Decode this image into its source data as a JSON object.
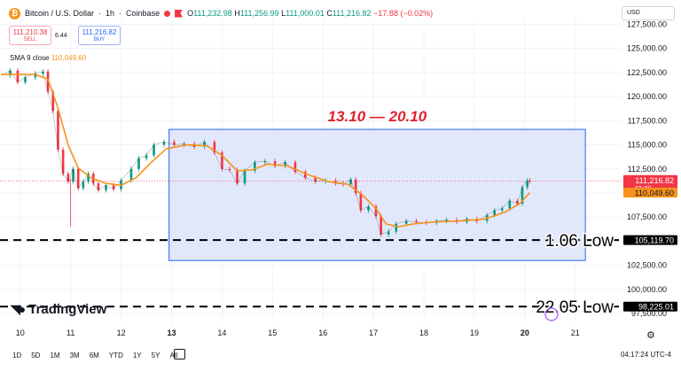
{
  "header": {
    "icon_glyph": "₿",
    "symbol": "Bitcoin / U.S. Dollar",
    "interval": "1h",
    "exchange": "Coinbase",
    "ohlc": [
      {
        "label": "O",
        "value": "111,232.98"
      },
      {
        "label": "H",
        "value": "111,256.99"
      },
      {
        "label": "L",
        "value": "111,000.01"
      },
      {
        "label": "C",
        "value": "111,216.82"
      }
    ],
    "change": "−17.88 (−0.02%)"
  },
  "trade": {
    "sell_price": "111,210.38",
    "sell_label": "SELL",
    "buy_price": "111,216.82",
    "buy_label": "BUY",
    "spread": "6.44"
  },
  "indicator": {
    "name": "SMA 9 close",
    "value": "110,049.60"
  },
  "currency": "USD",
  "logo_text": "TradingView",
  "timeframes": [
    "1D",
    "5D",
    "1M",
    "3M",
    "6M",
    "YTD",
    "1Y",
    "5Y",
    "All"
  ],
  "clock": "04:17:24 UTC-4",
  "colors": {
    "up": "#089981",
    "down": "#f23645",
    "sma": "#f7931a",
    "annotation": "#e0222f",
    "range_fill": "#dde4fc",
    "range_border": "#2962ff"
  },
  "chart_data": {
    "type": "candlestick",
    "x_unit": "day of month",
    "xticks": [
      "10",
      "11",
      "12",
      "13",
      "14",
      "15",
      "16",
      "17",
      "18",
      "19",
      "20",
      "21"
    ],
    "yticks": [
      "97,500.00",
      "100,000.00",
      "102,500.00",
      "105,000.00",
      "107,500.00",
      "110,000.00",
      "112,500.00",
      "115,000.00",
      "117,500.00",
      "120,000.00",
      "122,500.00",
      "125,000.00",
      "127,500.00"
    ],
    "ylim": [
      96500,
      128000
    ],
    "xlim": [
      9.6,
      21.9
    ],
    "price_labels": {
      "last": "111,216.82",
      "countdown": "42:36",
      "sma": "110,049.60",
      "low_1": "105,119.70",
      "low_2": "98,225.01"
    },
    "range": {
      "x0": 12.95,
      "x1": 21.2,
      "y0": 103000,
      "y1": 116600,
      "label": "13.10 — 20.10"
    },
    "lows": [
      {
        "label": "1.06 Low",
        "value": 105119.7
      },
      {
        "label": "22.05 Low",
        "value": 98225.01
      }
    ],
    "last_price": 111216.82,
    "series": [
      {
        "x": 9.62,
        "y": 122200
      },
      {
        "x": 9.8,
        "y": 122700
      },
      {
        "x": 9.95,
        "y": 121500
      },
      {
        "x": 10.1,
        "y": 122000
      },
      {
        "x": 10.3,
        "y": 122400
      },
      {
        "x": 10.45,
        "y": 122600
      },
      {
        "x": 10.55,
        "y": 120500
      },
      {
        "x": 10.65,
        "y": 118500
      },
      {
        "x": 10.75,
        "y": 114500
      },
      {
        "x": 10.85,
        "y": 112000
      },
      {
        "x": 10.95,
        "y": 111200
      },
      {
        "x": 11.05,
        "y": 112500
      },
      {
        "x": 11.15,
        "y": 110500
      },
      {
        "x": 11.25,
        "y": 111200
      },
      {
        "x": 11.35,
        "y": 112000
      },
      {
        "x": 11.45,
        "y": 111000
      },
      {
        "x": 11.55,
        "y": 110300
      },
      {
        "x": 11.7,
        "y": 110800
      },
      {
        "x": 11.85,
        "y": 110400
      },
      {
        "x": 12.0,
        "y": 111300
      },
      {
        "x": 12.2,
        "y": 112500
      },
      {
        "x": 12.35,
        "y": 113600
      },
      {
        "x": 12.5,
        "y": 113900
      },
      {
        "x": 12.65,
        "y": 115000
      },
      {
        "x": 12.85,
        "y": 115300
      },
      {
        "x": 13.05,
        "y": 115000
      },
      {
        "x": 13.25,
        "y": 115100
      },
      {
        "x": 13.45,
        "y": 114800
      },
      {
        "x": 13.65,
        "y": 115300
      },
      {
        "x": 13.85,
        "y": 114200
      },
      {
        "x": 14.0,
        "y": 112500
      },
      {
        "x": 14.15,
        "y": 112400
      },
      {
        "x": 14.3,
        "y": 111000
      },
      {
        "x": 14.45,
        "y": 112300
      },
      {
        "x": 14.65,
        "y": 113200
      },
      {
        "x": 14.85,
        "y": 113300
      },
      {
        "x": 15.05,
        "y": 112800
      },
      {
        "x": 15.25,
        "y": 113200
      },
      {
        "x": 15.45,
        "y": 112200
      },
      {
        "x": 15.65,
        "y": 111600
      },
      {
        "x": 15.85,
        "y": 111200
      },
      {
        "x": 16.05,
        "y": 111300
      },
      {
        "x": 16.25,
        "y": 111000
      },
      {
        "x": 16.4,
        "y": 110900
      },
      {
        "x": 16.55,
        "y": 111400
      },
      {
        "x": 16.65,
        "y": 110000
      },
      {
        "x": 16.75,
        "y": 108200
      },
      {
        "x": 16.9,
        "y": 108600
      },
      {
        "x": 17.05,
        "y": 107600
      },
      {
        "x": 17.15,
        "y": 105700
      },
      {
        "x": 17.3,
        "y": 106000
      },
      {
        "x": 17.45,
        "y": 106800
      },
      {
        "x": 17.65,
        "y": 107100
      },
      {
        "x": 17.85,
        "y": 107000
      },
      {
        "x": 18.05,
        "y": 106900
      },
      {
        "x": 18.25,
        "y": 107100
      },
      {
        "x": 18.45,
        "y": 107200
      },
      {
        "x": 18.65,
        "y": 107000
      },
      {
        "x": 18.85,
        "y": 107300
      },
      {
        "x": 19.05,
        "y": 107100
      },
      {
        "x": 19.25,
        "y": 107700
      },
      {
        "x": 19.4,
        "y": 108200
      },
      {
        "x": 19.55,
        "y": 108400
      },
      {
        "x": 19.7,
        "y": 109200
      },
      {
        "x": 19.85,
        "y": 108900
      },
      {
        "x": 19.95,
        "y": 110600
      },
      {
        "x": 20.05,
        "y": 111300
      },
      {
        "x": 20.1,
        "y": 111217
      }
    ],
    "sma": [
      {
        "x": 9.62,
        "y": 122300
      },
      {
        "x": 10.3,
        "y": 122300
      },
      {
        "x": 10.55,
        "y": 121800
      },
      {
        "x": 10.75,
        "y": 118800
      },
      {
        "x": 10.95,
        "y": 115000
      },
      {
        "x": 11.15,
        "y": 112600
      },
      {
        "x": 11.4,
        "y": 111600
      },
      {
        "x": 11.7,
        "y": 111000
      },
      {
        "x": 12.0,
        "y": 110800
      },
      {
        "x": 12.3,
        "y": 111600
      },
      {
        "x": 12.6,
        "y": 113200
      },
      {
        "x": 12.9,
        "y": 114600
      },
      {
        "x": 13.3,
        "y": 115000
      },
      {
        "x": 13.7,
        "y": 114900
      },
      {
        "x": 14.0,
        "y": 113900
      },
      {
        "x": 14.3,
        "y": 112300
      },
      {
        "x": 14.6,
        "y": 112400
      },
      {
        "x": 14.9,
        "y": 113000
      },
      {
        "x": 15.3,
        "y": 112800
      },
      {
        "x": 15.7,
        "y": 111900
      },
      {
        "x": 16.1,
        "y": 111200
      },
      {
        "x": 16.5,
        "y": 110900
      },
      {
        "x": 16.8,
        "y": 109700
      },
      {
        "x": 17.05,
        "y": 108400
      },
      {
        "x": 17.25,
        "y": 106800
      },
      {
        "x": 17.5,
        "y": 106500
      },
      {
        "x": 17.8,
        "y": 106800
      },
      {
        "x": 18.2,
        "y": 107000
      },
      {
        "x": 18.7,
        "y": 107100
      },
      {
        "x": 19.2,
        "y": 107300
      },
      {
        "x": 19.6,
        "y": 108000
      },
      {
        "x": 19.9,
        "y": 108900
      },
      {
        "x": 20.1,
        "y": 110050
      }
    ]
  }
}
